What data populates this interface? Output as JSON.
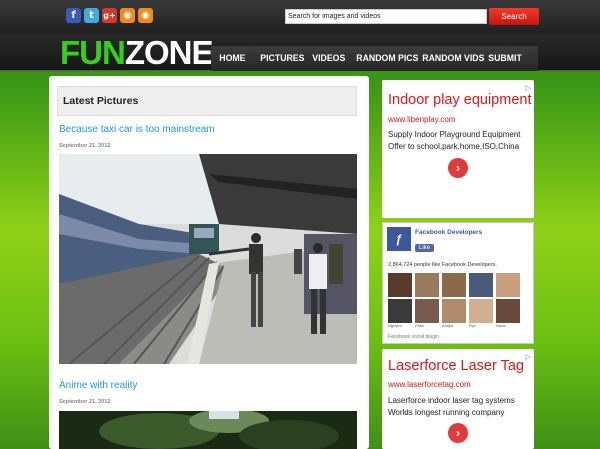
{
  "social": [
    {
      "name": "facebook-icon",
      "glyph": "f",
      "cls": "fb"
    },
    {
      "name": "twitter-icon",
      "glyph": "t",
      "cls": "tw"
    },
    {
      "name": "google-plus-icon",
      "glyph": "g+",
      "cls": "gp"
    },
    {
      "name": "rss-icon",
      "glyph": "◉",
      "cls": "rss"
    },
    {
      "name": "rss-icon-2",
      "glyph": "◉",
      "cls": "rss"
    }
  ],
  "search": {
    "placeholder": "Search for images and videos",
    "button_label": "Search"
  },
  "logo": {
    "part1": "FUN",
    "part2": "ZONE"
  },
  "nav": {
    "items": [
      "HOME",
      "PICTURES",
      "VIDEOS",
      "RANDOM PICS",
      "RANDOM VIDS",
      "SUBMIT"
    ]
  },
  "main": {
    "section_title": "Latest Pictures",
    "posts": [
      {
        "title": "Because taxi car is too mainstream",
        "date": "September 21, 2012"
      },
      {
        "title": "Anime with reality",
        "date": "September 21, 2012"
      }
    ]
  },
  "ads": [
    {
      "title": "Indoor play equipment",
      "url": "www.libenplay.com",
      "text": "Supply Indoor Playground Equipment Offer to school,park,home,ISO,China",
      "button": "›",
      "mark": "▷"
    },
    {
      "title": "Laserforce Laser Tag",
      "url": "www.laserforcetag.com",
      "text": "Laserforce indoor laser tag systems Worlds longest running company",
      "button": "›",
      "mark": "▷"
    }
  ],
  "facebook": {
    "page_name": "Facebook Developers",
    "like_label": "Like",
    "count_text": "2,864,724 people like Facebook Developers.",
    "plugin_text": "Facebook social plugin",
    "faces": [
      "Tim",
      "Jade",
      "Jude",
      "Jessie",
      "Eliot",
      "Nguyen",
      "Peter",
      "Aditya",
      "Ryo",
      "Hana"
    ],
    "face_colors": [
      "#5a3a2a",
      "#9a7a5a",
      "#8b6a4a",
      "#4a5a7a",
      "#c8a080",
      "#3a3a3a",
      "#7a5a4a",
      "#b08a6a",
      "#d0b090",
      "#6a4a3a"
    ]
  }
}
